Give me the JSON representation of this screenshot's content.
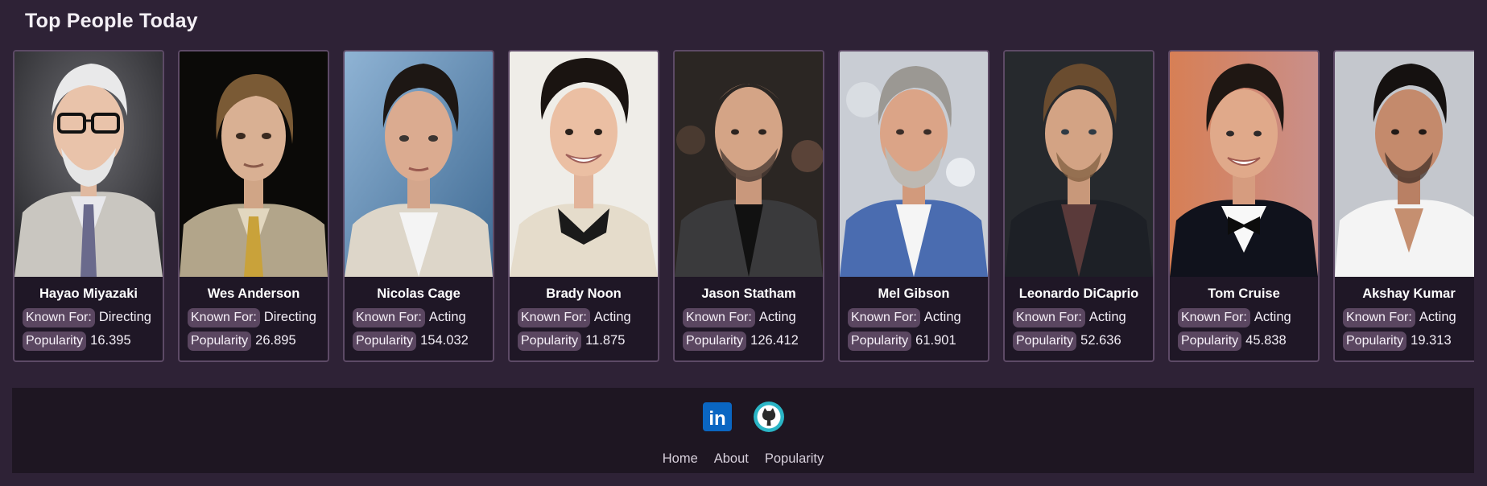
{
  "section": {
    "title": "Top People Today"
  },
  "labels": {
    "known_for": "Known For:",
    "popularity": "Popularity"
  },
  "people": [
    {
      "name": "Hayao Miyazaki",
      "known_for": "Directing",
      "popularity": "16.395"
    },
    {
      "name": "Wes Anderson",
      "known_for": "Directing",
      "popularity": "26.895"
    },
    {
      "name": "Nicolas Cage",
      "known_for": "Acting",
      "popularity": "154.032"
    },
    {
      "name": "Brady Noon",
      "known_for": "Acting",
      "popularity": "11.875"
    },
    {
      "name": "Jason Statham",
      "known_for": "Acting",
      "popularity": "126.412"
    },
    {
      "name": "Mel Gibson",
      "known_for": "Acting",
      "popularity": "61.901"
    },
    {
      "name": "Leonardo DiCaprio",
      "known_for": "Acting",
      "popularity": "52.636"
    },
    {
      "name": "Tom Cruise",
      "known_for": "Acting",
      "popularity": "45.838"
    },
    {
      "name": "Akshay Kumar",
      "known_for": "Acting",
      "popularity": "19.313"
    }
  ],
  "footer": {
    "social": [
      {
        "icon": "linkedin-icon",
        "glyph": "in"
      },
      {
        "icon": "github-icon"
      }
    ],
    "links": [
      "Home",
      "About",
      "Popularity"
    ]
  },
  "colors": {
    "page_bg": "#2e2236",
    "card_bg": "#1f1726",
    "card_border": "#5d4a66",
    "pill_bg": "#5a4660",
    "footer_bg": "#1e1622",
    "linkedin_blue": "#0a66c2",
    "github_teal": "#2ab5c6"
  }
}
